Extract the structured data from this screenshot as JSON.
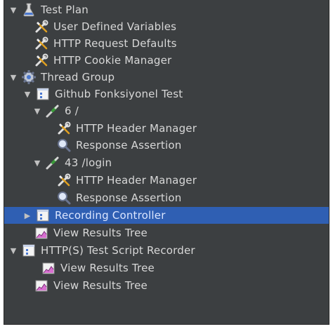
{
  "tree": {
    "test_plan": "Test Plan",
    "user_defined_variables": "User Defined Variables",
    "http_request_defaults": "HTTP Request Defaults",
    "http_cookie_manager": "HTTP Cookie Manager",
    "thread_group": "Thread Group",
    "github_test": "Github Fonksiyonel Test",
    "sampler_6": "6 /",
    "header_manager_1": "HTTP Header Manager",
    "response_assertion_1": "Response Assertion",
    "sampler_43": "43 /login",
    "header_manager_2": "HTTP Header Manager",
    "response_assertion_2": "Response Assertion",
    "recording_controller": "Recording Controller",
    "view_results_tree_1": "View Results Tree",
    "script_recorder": "HTTP(S) Test Script Recorder",
    "view_results_tree_2": "View Results Tree",
    "view_results_tree_3": "View Results Tree"
  },
  "icons": {
    "expanded": "triangle-down",
    "collapsed": "triangle-right"
  },
  "colors": {
    "background": "#3c3f41",
    "selection": "#2f5fb3",
    "text": "#d8d8d8"
  }
}
